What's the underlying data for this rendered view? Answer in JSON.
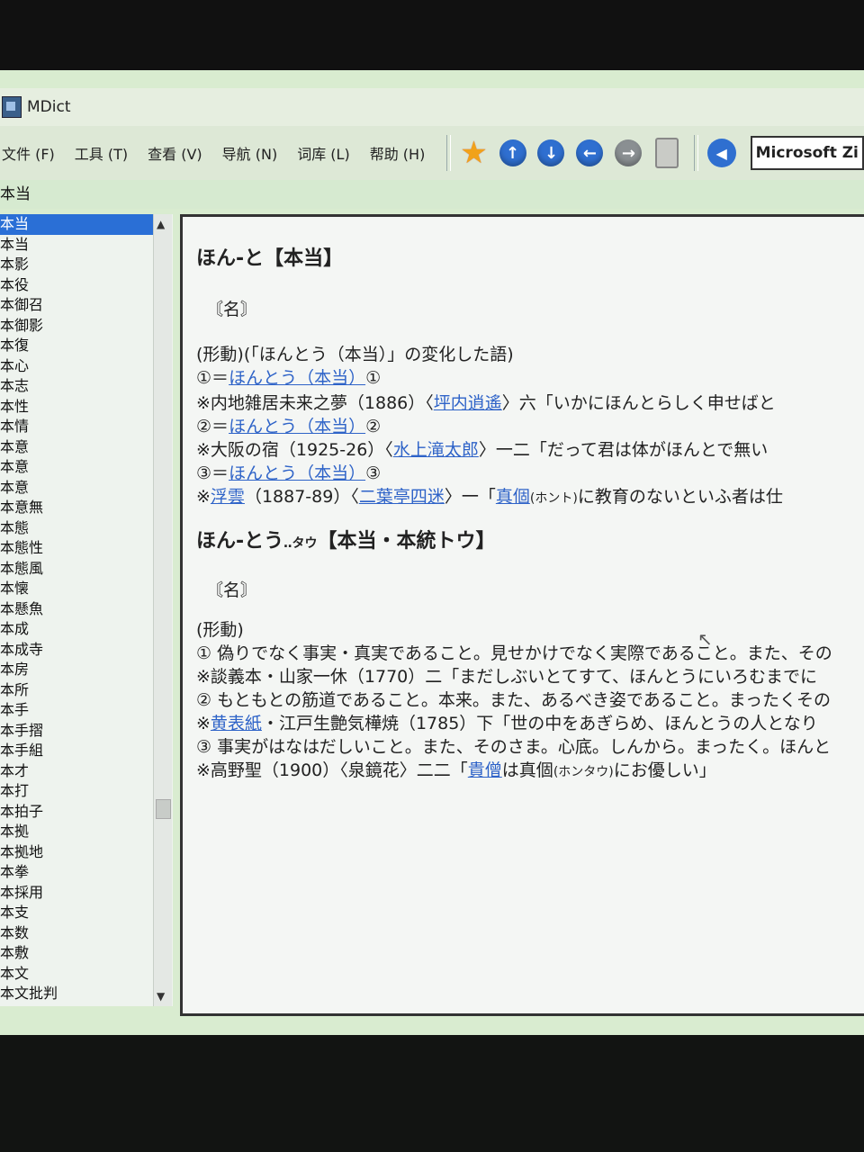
{
  "window": {
    "title": "MDict"
  },
  "menu": [
    "文件 (F)",
    "工具 (T)",
    "查看 (V)",
    "导航 (N)",
    "词库 (L)",
    "帮助 (H)"
  ],
  "toolbar": {
    "icons": [
      "favorites-star-icon",
      "arrow-up-icon",
      "arrow-down-icon",
      "arrow-left-icon",
      "arrow-right-icon",
      "clipboard-icon"
    ],
    "speaker_icon": "speaker-icon",
    "dictionary": "Microsoft Zi"
  },
  "search": {
    "value": "本当"
  },
  "word_list": {
    "selected_index": 0,
    "items": [
      "本当",
      "本当",
      "本影",
      "本役",
      "本御召",
      "本御影",
      "本復",
      "本心",
      "本志",
      "本性",
      "本情",
      "本意",
      "本意",
      "本意",
      "本意無",
      "本態",
      "本態性",
      "本態風",
      "本懐",
      "本懸魚",
      "本成",
      "本成寺",
      "本房",
      "本所",
      "本手",
      "本手摺",
      "本手組",
      "本才",
      "本打",
      "本拍子",
      "本拠",
      "本拠地",
      "本拳",
      "本採用",
      "本支",
      "本数",
      "本敷",
      "本文",
      "本文批判"
    ]
  },
  "entry1": {
    "headword": "ほん-と【本当】",
    "pos": "〘名〙",
    "def": "(形動)(「ほんとう（本当）」の変化した語)",
    "senses": [
      {
        "num": "①",
        "eq": "＝",
        "link": "ほんとう（本当）",
        "sub": "①"
      },
      {
        "num": "②",
        "eq": "＝",
        "link": "ほんとう（本当）",
        "sub": "②"
      },
      {
        "num": "③",
        "eq": "＝",
        "link": "ほんとう（本当）",
        "sub": "③"
      }
    ],
    "cites": [
      {
        "pre": "※内地雑居未来之夢（1886）〈",
        "link": "坪内逍遙",
        "post": "〉六「いかにほんとらしく申せばと"
      },
      {
        "pre": "※大阪の宿（1925-26）〈",
        "link": "水上滝太郎",
        "post": "〉一二「だって君は体がほんとで無い"
      },
      {
        "pre": "※",
        "link1": "浮雲",
        "mid": "（1887-89）〈",
        "link2": "二葉亭四迷",
        "mid2": "〉一「",
        "link3": "真個",
        "small": "(ホント)",
        "post": "に教育のないといふ者は仕"
      }
    ]
  },
  "entry2": {
    "headword": "ほん-とう",
    "reading": "‥タウ",
    "kanji": "【本当・本統トウ】",
    "pos": "〘名〙",
    "def": "(形動)",
    "lines": [
      "① 偽りでなく事実・真実であること。見せかけでなく実際であること。また、その",
      "※談義本・山家一休（1770）二「まだしぶいとてすて、ほんとうにいろむまでに",
      "② もともとの筋道であること。本来。また、あるべき姿であること。まったくその"
    ],
    "cite4": {
      "pre": "※",
      "link": "黄表紙",
      "post": "・江戸生艶気樺焼（1785）下「世の中をあぎらめ、ほんとうの人となり"
    },
    "line5": "③ 事実がはなはだしいこと。また、そのさま。心底。しんから。まったく。ほんと",
    "cite6": {
      "pre": "※高野聖（1900）〈泉鏡花〉二二「",
      "link": "貴僧",
      "mid": "は真個",
      "small": "(ホンタウ)",
      "post": "にお優しい」"
    }
  }
}
